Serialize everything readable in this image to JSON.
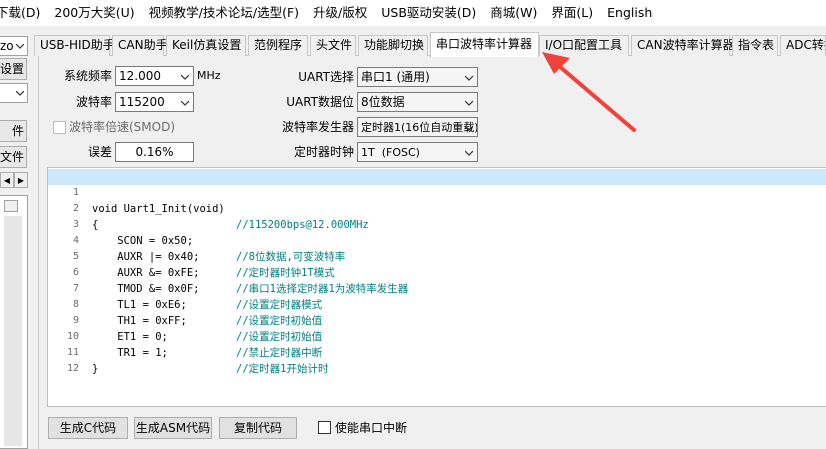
{
  "menu": [
    "下载(D)",
    "200万大奖(U)",
    "视频教学/技术论坛/选型(F)",
    "升级/版权",
    "USB驱动安装(D)",
    "商城(W)",
    "界面(L)",
    "English"
  ],
  "left_panel": {
    "combo_text": "zo",
    "btn1": "设置",
    "btn2": "件",
    "btn3": "文件"
  },
  "tabs": [
    "USB-HID助手",
    "CAN助手",
    "Keil仿真设置",
    "范例程序",
    "头文件",
    "功能脚切换",
    "串口波特率计算器",
    "I/O口配置工具",
    "CAN波特率计算器",
    "指令表",
    "ADC转换"
  ],
  "active_tab_index": 6,
  "form": {
    "sysfreq_label": "系统频率",
    "sysfreq_value": "12.000",
    "sysfreq_unit": "MHz",
    "baud_label": "波特率",
    "baud_value": "115200",
    "smod_label": "波特率倍速(SMOD)",
    "error_label": "误差",
    "error_value": "0.16%",
    "uart_select_label": "UART选择",
    "uart_select_value": "串口1 (通用)",
    "uart_bits_label": "UART数据位",
    "uart_bits_value": "8位数据",
    "baud_gen_label": "波特率发生器",
    "baud_gen_value": "定时器1(16位自动重载)",
    "timer_clock_label": "定时器时钟",
    "timer_clock_value": "1T  (FOSC)"
  },
  "code_lines": [
    {
      "n": "1",
      "code": "void Uart1_Init(void)",
      "comment": "//115200bps@12.000MHz"
    },
    {
      "n": "2",
      "code": "{",
      "comment": ""
    },
    {
      "n": "3",
      "code": "    SCON = 0x50;",
      "comment": "//8位数据,可变波特率"
    },
    {
      "n": "4",
      "code": "    AUXR |= 0x40;",
      "comment": "//定时器时钟1T模式"
    },
    {
      "n": "5",
      "code": "    AUXR &= 0xFE;",
      "comment": "//串口1选择定时器1为波特率发生器"
    },
    {
      "n": "6",
      "code": "    TMOD &= 0x0F;",
      "comment": "//设置定时器模式"
    },
    {
      "n": "7",
      "code": "    TL1 = 0xE6;",
      "comment": "//设置定时初始值"
    },
    {
      "n": "8",
      "code": "    TH1 = 0xFF;",
      "comment": "//设置定时初始值"
    },
    {
      "n": "9",
      "code": "    ET1 = 0;",
      "comment": "//禁止定时器中断"
    },
    {
      "n": "10",
      "code": "    TR1 = 1;",
      "comment": "//定时器1开始计时"
    },
    {
      "n": "11",
      "code": "}",
      "comment": ""
    },
    {
      "n": "12",
      "code": "",
      "comment": ""
    }
  ],
  "buttons": {
    "gen_c": "生成C代码",
    "gen_asm": "生成ASM代码",
    "copy": "复制代码",
    "enable_irq": "使能串口中断"
  },
  "colors": {
    "highlight_line": "#cce8ff",
    "comment": "#008080",
    "keyword": "#0000c8",
    "annotation_arrow": "#f0413c"
  }
}
